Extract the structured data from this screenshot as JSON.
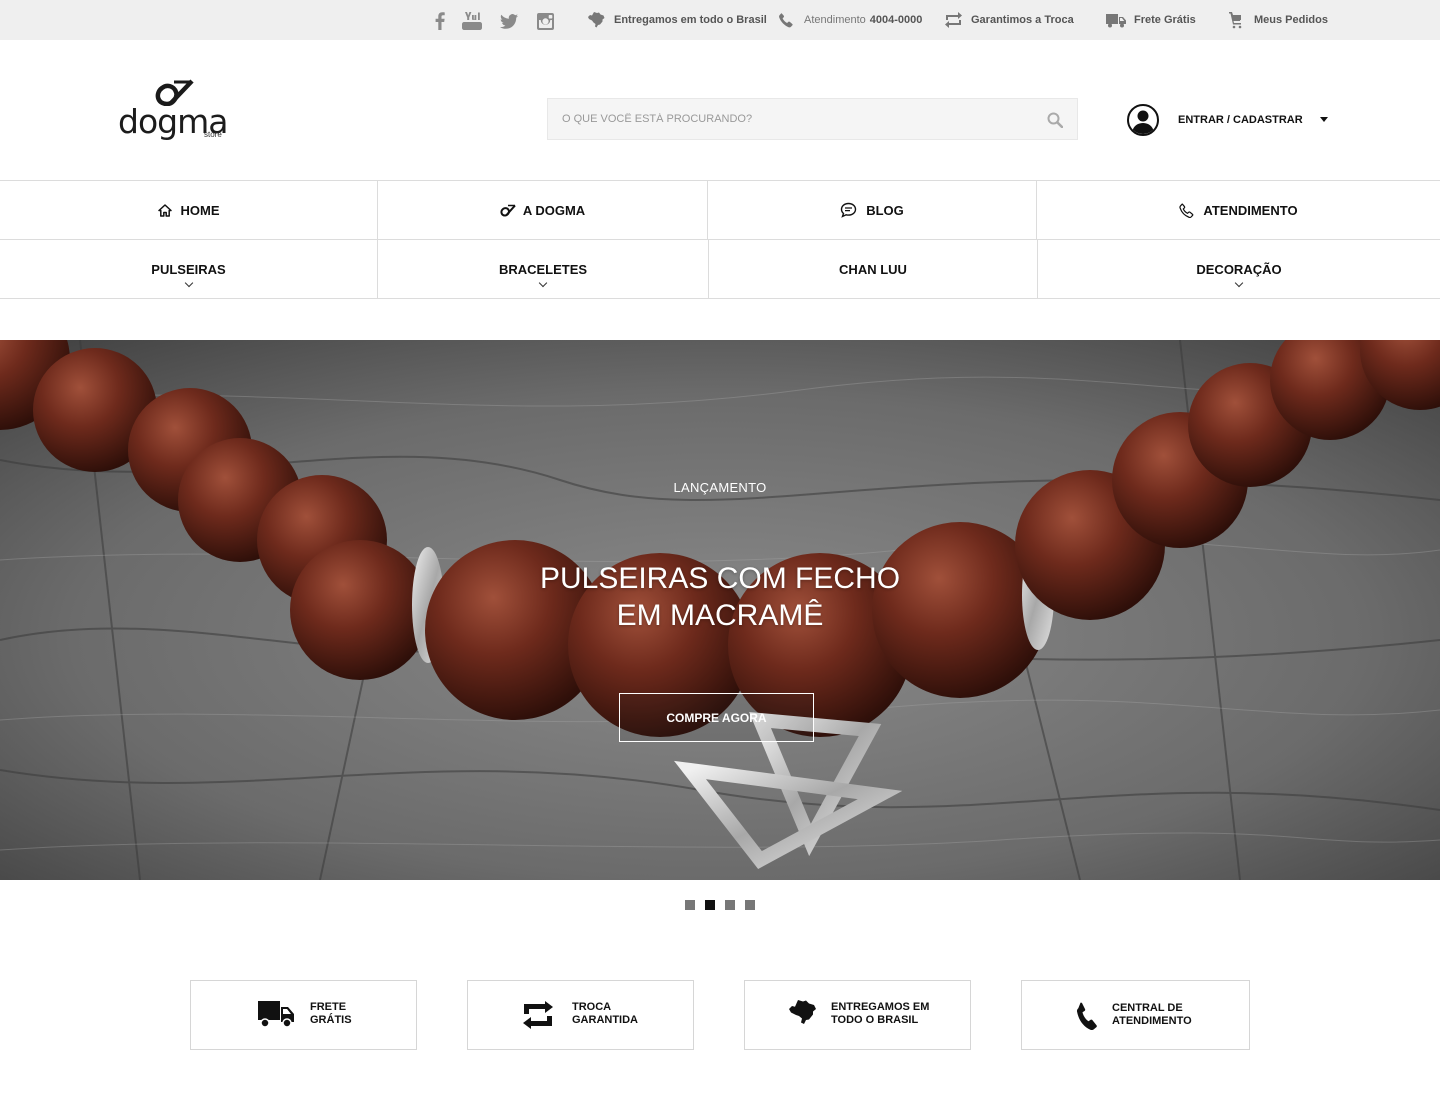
{
  "topbar": {
    "social": [
      "facebook-icon",
      "youtube-icon",
      "twitter-icon",
      "instagram-icon"
    ],
    "info": {
      "delivery": "Entregamos em todo o Brasil",
      "support_label": "Atendimento",
      "support_phone": "4004-0000",
      "exchange": "Garantimos a Troca",
      "shipping": "Frete Grátis",
      "orders": "Meus Pedidos"
    }
  },
  "header": {
    "logo_word": "dogma",
    "logo_sub": "store",
    "search_placeholder": "O QUE VOCÊ ESTÁ PROCURANDO?",
    "search_value": "",
    "account_label": "ENTRAR / CADASTRAR"
  },
  "nav": {
    "primary": [
      {
        "label": "HOME",
        "icon": "home-icon"
      },
      {
        "label": "A DOGMA",
        "icon": "dogma-logo-icon"
      },
      {
        "label": "BLOG",
        "icon": "chat-bubble-icon"
      },
      {
        "label": "ATENDIMENTO",
        "icon": "phone-icon"
      }
    ],
    "categories": [
      {
        "label": "PULSEIRAS",
        "has_dropdown": true
      },
      {
        "label": "BRACELETES",
        "has_dropdown": true
      },
      {
        "label": "CHAN LUU",
        "has_dropdown": false
      },
      {
        "label": "DECORAÇÃO",
        "has_dropdown": true
      }
    ]
  },
  "hero": {
    "eyebrow": "LANÇAMENTO",
    "headline_line1": "PULSEIRAS COM FECHO",
    "headline_line2": "EM MACRAMÊ",
    "cta": "COMPRE AGORA",
    "slides_total": 4,
    "active_slide": 2
  },
  "features": [
    {
      "text": "FRETE\nGRÁTIS",
      "icon": "truck-icon"
    },
    {
      "text": "TROCA\nGARANTIDA",
      "icon": "exchange-arrows-icon"
    },
    {
      "text": "ENTREGAMOS EM\nTODO O BRASIL",
      "icon": "brazil-map-icon"
    },
    {
      "text": "CENTRAL DE\nATENDIMENTO",
      "icon": "phone-handset-icon"
    }
  ],
  "colors": {
    "topbar_bg": "#efefef",
    "text": "#111111",
    "border": "#dcdcdc",
    "dot_active": "#111111",
    "dot_inactive": "#777777"
  }
}
